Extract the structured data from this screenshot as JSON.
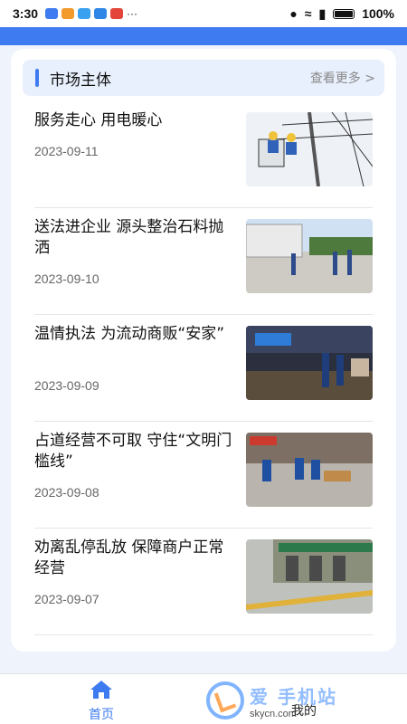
{
  "status_bar": {
    "time": "3:30",
    "battery": "100%"
  },
  "section": {
    "title": "市场主体",
    "more": "查看更多 >"
  },
  "news": [
    {
      "title": "服务走心 用电暖心",
      "date": "2023-09-11",
      "thumb": "power-line-workers"
    },
    {
      "title": "送法进企业 源头整治石料抛洒",
      "date": "2023-09-10",
      "thumb": "yard-inspection"
    },
    {
      "title": "温情执法 为流动商贩“安家”",
      "date": "2023-09-09",
      "thumb": "night-street"
    },
    {
      "title": "占道经营不可取 守住“文明门槛线”",
      "date": "2023-09-08",
      "thumb": "street-vendor"
    },
    {
      "title": "劝离乱停乱放 保障商户正常经营",
      "date": "2023-09-07",
      "thumb": "shop-front"
    }
  ],
  "tabbar": {
    "home_label": "首页",
    "mine_label": "我的"
  },
  "watermark": {
    "title": "爱 手机站",
    "url": "skycn.com"
  },
  "colors": {
    "accent": "#3f7bf0",
    "background": "#eef3fc"
  }
}
